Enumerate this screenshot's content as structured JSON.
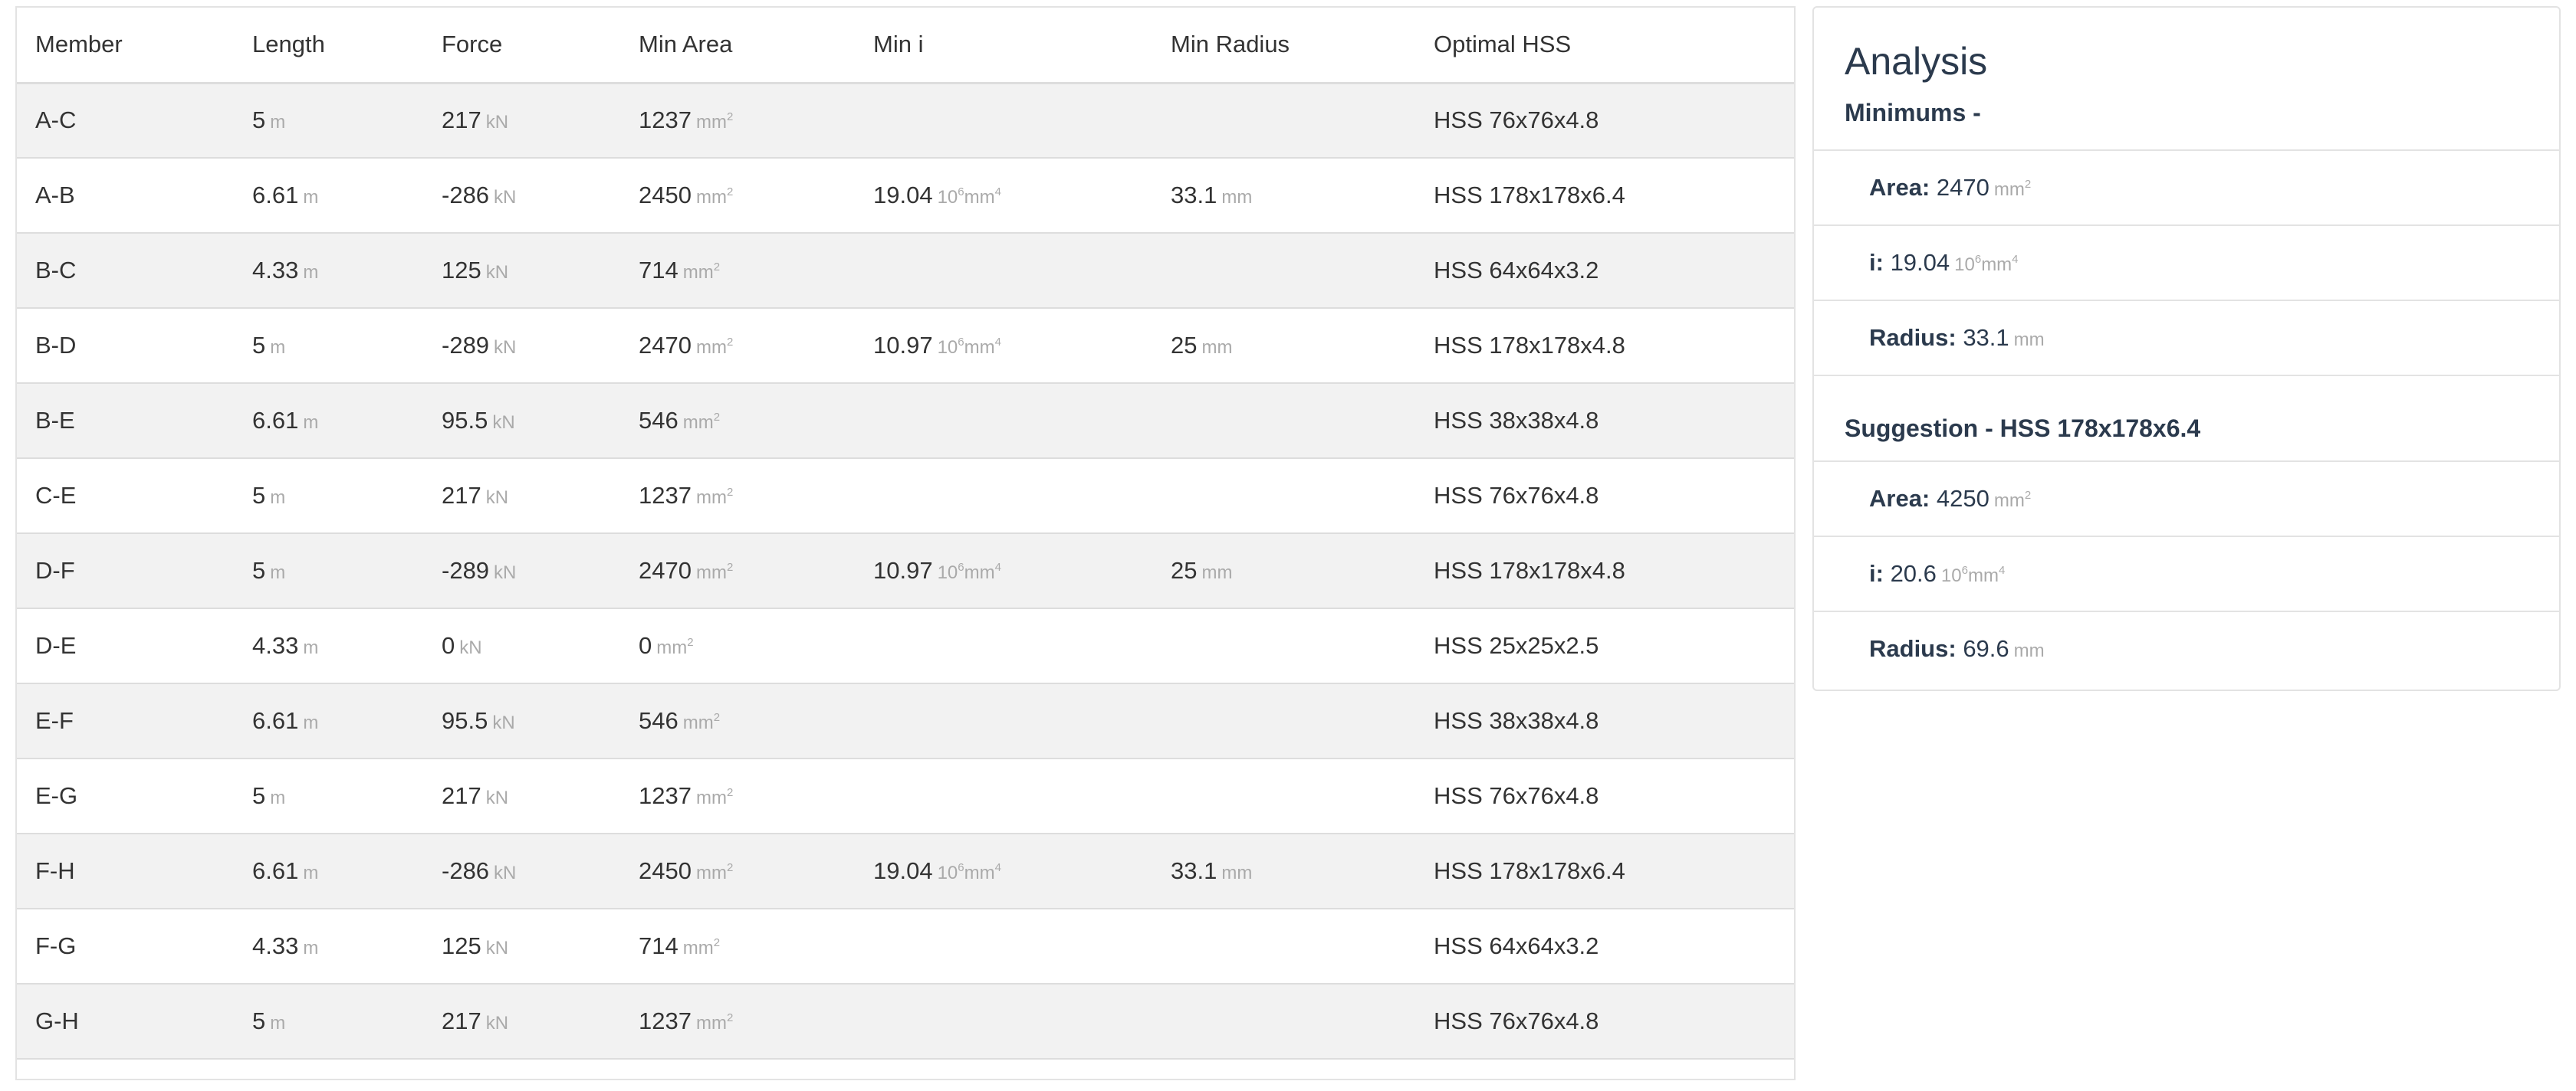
{
  "table": {
    "headers": [
      "Member",
      "Length",
      "Force",
      "Min Area",
      "Min i",
      "Min Radius",
      "Optimal HSS"
    ],
    "units": {
      "length": "m",
      "force": "kN",
      "area": "mm",
      "area_exp": "2",
      "i_base": "10",
      "i_base_exp": "6",
      "i_unit": "mm",
      "i_unit_exp": "4",
      "radius": "mm"
    },
    "rows": [
      {
        "member": "A-C",
        "length": "5",
        "force": "217",
        "area": "1237",
        "i": "",
        "radius": "",
        "hss": "HSS 76x76x4.8"
      },
      {
        "member": "A-B",
        "length": "6.61",
        "force": "-286",
        "area": "2450",
        "i": "19.04",
        "radius": "33.1",
        "hss": "HSS 178x178x6.4"
      },
      {
        "member": "B-C",
        "length": "4.33",
        "force": "125",
        "area": "714",
        "i": "",
        "radius": "",
        "hss": "HSS 64x64x3.2"
      },
      {
        "member": "B-D",
        "length": "5",
        "force": "-289",
        "area": "2470",
        "i": "10.97",
        "radius": "25",
        "hss": "HSS 178x178x4.8"
      },
      {
        "member": "B-E",
        "length": "6.61",
        "force": "95.5",
        "area": "546",
        "i": "",
        "radius": "",
        "hss": "HSS 38x38x4.8"
      },
      {
        "member": "C-E",
        "length": "5",
        "force": "217",
        "area": "1237",
        "i": "",
        "radius": "",
        "hss": "HSS 76x76x4.8"
      },
      {
        "member": "D-F",
        "length": "5",
        "force": "-289",
        "area": "2470",
        "i": "10.97",
        "radius": "25",
        "hss": "HSS 178x178x4.8"
      },
      {
        "member": "D-E",
        "length": "4.33",
        "force": "0",
        "area": "0",
        "i": "",
        "radius": "",
        "hss": "HSS 25x25x2.5"
      },
      {
        "member": "E-F",
        "length": "6.61",
        "force": "95.5",
        "area": "546",
        "i": "",
        "radius": "",
        "hss": "HSS 38x38x4.8"
      },
      {
        "member": "E-G",
        "length": "5",
        "force": "217",
        "area": "1237",
        "i": "",
        "radius": "",
        "hss": "HSS 76x76x4.8"
      },
      {
        "member": "F-H",
        "length": "6.61",
        "force": "-286",
        "area": "2450",
        "i": "19.04",
        "radius": "33.1",
        "hss": "HSS 178x178x6.4"
      },
      {
        "member": "F-G",
        "length": "4.33",
        "force": "125",
        "area": "714",
        "i": "",
        "radius": "",
        "hss": "HSS 64x64x3.2"
      },
      {
        "member": "G-H",
        "length": "5",
        "force": "217",
        "area": "1237",
        "i": "",
        "radius": "",
        "hss": "HSS 76x76x4.8"
      }
    ]
  },
  "analysis": {
    "title": "Analysis",
    "minimums": {
      "heading": "Minimums -",
      "area_label": "Area:",
      "area_value": "2470",
      "i_label": "i:",
      "i_value": "19.04",
      "radius_label": "Radius:",
      "radius_value": "33.1"
    },
    "suggestion": {
      "heading": "Suggestion - HSS 178x178x6.4",
      "area_label": "Area:",
      "area_value": "4250",
      "i_label": "i:",
      "i_value": "20.6",
      "radius_label": "Radius:",
      "radius_value": "69.6"
    }
  }
}
